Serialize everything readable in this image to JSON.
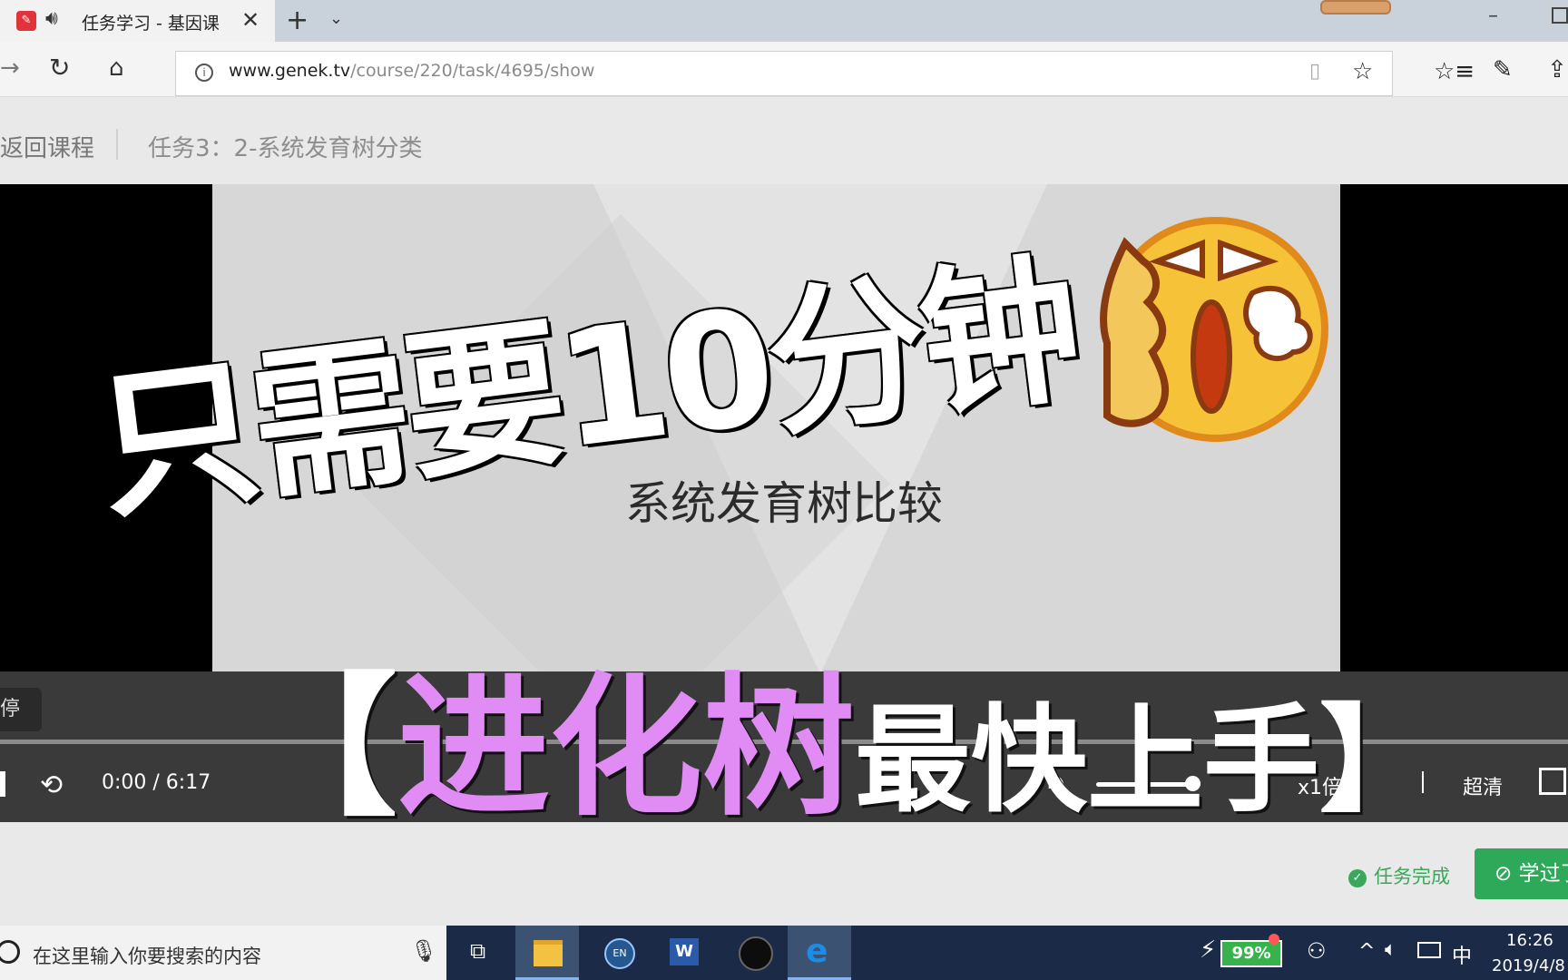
{
  "browser": {
    "tab_title": "任务学习 - 基因课",
    "favicon_label": "✎",
    "url_domain": "www.genek.tv",
    "url_path": "/course/220/task/4695/show"
  },
  "page": {
    "back_label": "返回课程",
    "task_title": "任务3：2-系统发育树分类"
  },
  "player": {
    "slide_title": "系统发育树比较",
    "pause_tooltip": "停",
    "time": "0:00 / 6:17",
    "speed_label": "x1倍速",
    "quality_label": "超清",
    "volume_level": 0.92,
    "progress": 0.0
  },
  "overlay": {
    "line1": "只需要10分钟",
    "bracket_open": "【",
    "highlight": "进化树",
    "rest": "最快上手",
    "bracket_close": "】"
  },
  "task_actions": {
    "status_label": "任务完成",
    "learned_label": "学过了"
  },
  "taskbar": {
    "search_placeholder": "在这里输入你要搜索的内容",
    "en_badge": "EN",
    "word_badge": "W",
    "battery": "99%",
    "ime": "中",
    "time": "16:26",
    "date": "2019/4/8"
  },
  "colors": {
    "overlay_highlight": "#e08cf4",
    "success_green": "#2ea95a",
    "taskbar": "#1b2a47"
  },
  "icons": [
    "audio-icon",
    "close-icon",
    "new-tab-icon",
    "chevron-down-icon",
    "forward-icon",
    "refresh-icon",
    "home-icon",
    "info-icon",
    "reading-view-icon",
    "star-icon",
    "favorites-icon",
    "pen-icon",
    "share-icon",
    "replay-icon",
    "volume-icon",
    "fullscreen-icon",
    "check-icon",
    "search-icon",
    "mic-icon",
    "task-view-icon",
    "plug-icon",
    "people-icon",
    "chevron-up-icon",
    "network-icon"
  ]
}
